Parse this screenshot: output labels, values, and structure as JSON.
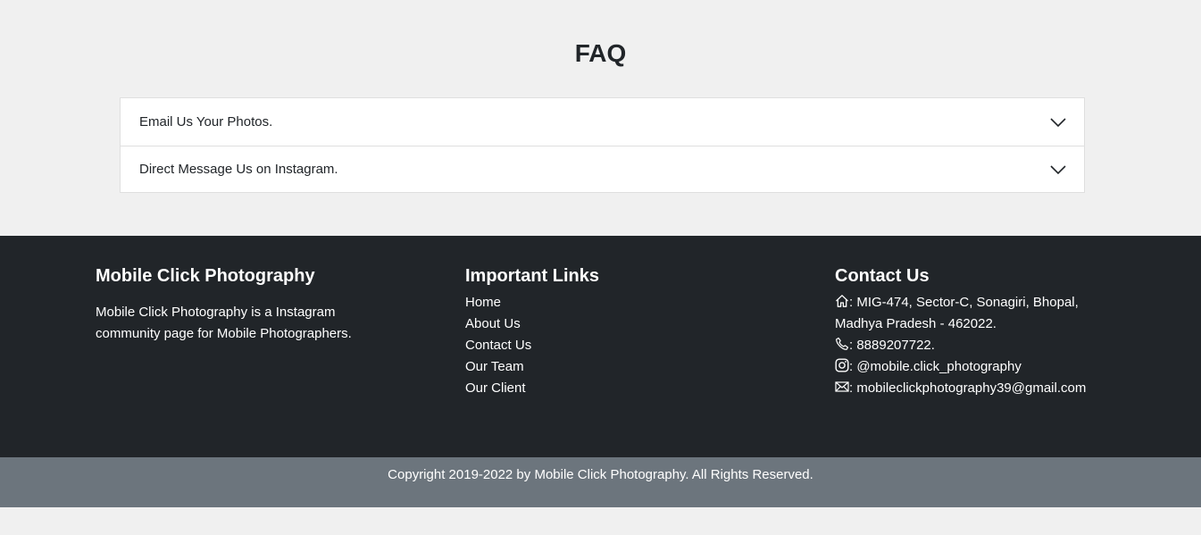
{
  "faq": {
    "title": "FAQ",
    "items": [
      {
        "question": "Email Us Your Photos."
      },
      {
        "question": "Direct Message Us on Instagram."
      }
    ]
  },
  "footer": {
    "about": {
      "heading": "Mobile Click Photography",
      "text": "Mobile Click Photography is a Instagram community page for Mobile Photographers."
    },
    "links": {
      "heading": "Important Links",
      "items": [
        "Home",
        "About Us",
        "Contact Us",
        "Our Team",
        "Our Client"
      ]
    },
    "contact": {
      "heading": "Contact Us",
      "address_line1": ": MIG-474, Sector-C, Sonagiri, Bhopal,",
      "address_line2": "Madhya Pradesh - 462022.",
      "phone": ": 8889207722.",
      "instagram": ": @mobile.click_photography",
      "email": ": mobileclickphotography39@gmail.com",
      "icons": [
        "home-icon",
        "phone-icon",
        "instagram-icon",
        "envelope-icon"
      ]
    },
    "copyright": "Copyright 2019-2022 by Mobile Click Photography. All Rights Reserved."
  },
  "colors": {
    "page_bg": "#f0f0f0",
    "footer_bg": "#212529",
    "copyright_bg": "#6c757d",
    "accordion_border": "#dfdfdf"
  }
}
